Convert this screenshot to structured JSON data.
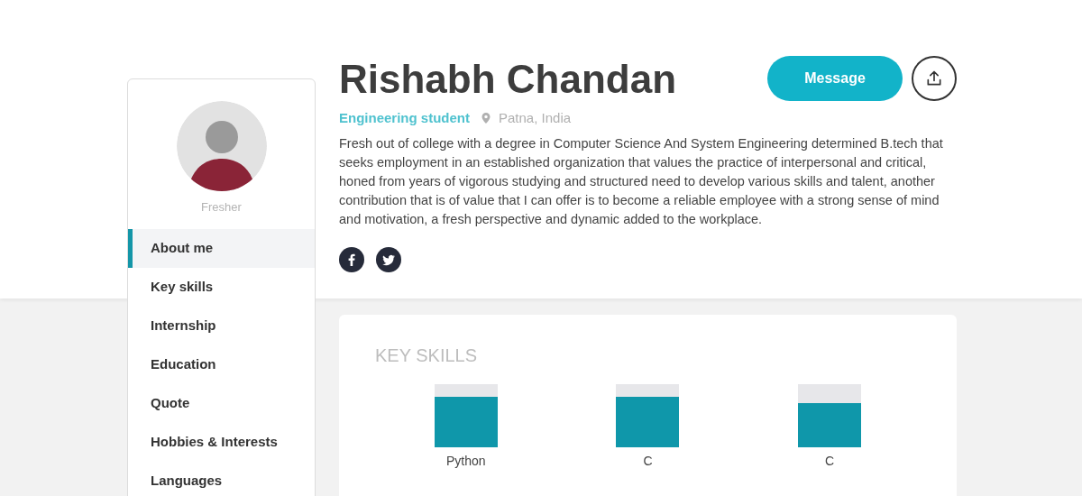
{
  "profile": {
    "name": "Rishabh Chandan",
    "role": "Engineering student",
    "location": "Patna, India",
    "status": "Fresher",
    "bio": "Fresh out of college with a degree in Computer Science And System Engineering determined B.tech that seeks employment in an established organization that values the practice of interpersonal and critical, honed from years of vigorous studying and structured need to develop various skills and talent, another contribution that is of value that I can offer is to become a reliable employee with a strong sense of mind and motivation, a fresh perspective and dynamic added to the workplace."
  },
  "actions": {
    "message_button": "Message"
  },
  "social_links": [
    {
      "kind": "facebook"
    },
    {
      "kind": "twitter"
    }
  ],
  "sidebar": {
    "items": [
      {
        "label": "About me",
        "selected": true
      },
      {
        "label": "Key skills",
        "selected": false
      },
      {
        "label": "Internship",
        "selected": false
      },
      {
        "label": "Education",
        "selected": false
      },
      {
        "label": "Quote",
        "selected": false
      },
      {
        "label": "Hobbies & Interests",
        "selected": false
      },
      {
        "label": "Languages",
        "selected": false
      }
    ]
  },
  "key_skills": {
    "title": "KEY SKILLS",
    "skills": [
      {
        "name": "Python"
      },
      {
        "name": "C"
      },
      {
        "name": "C"
      }
    ]
  }
}
